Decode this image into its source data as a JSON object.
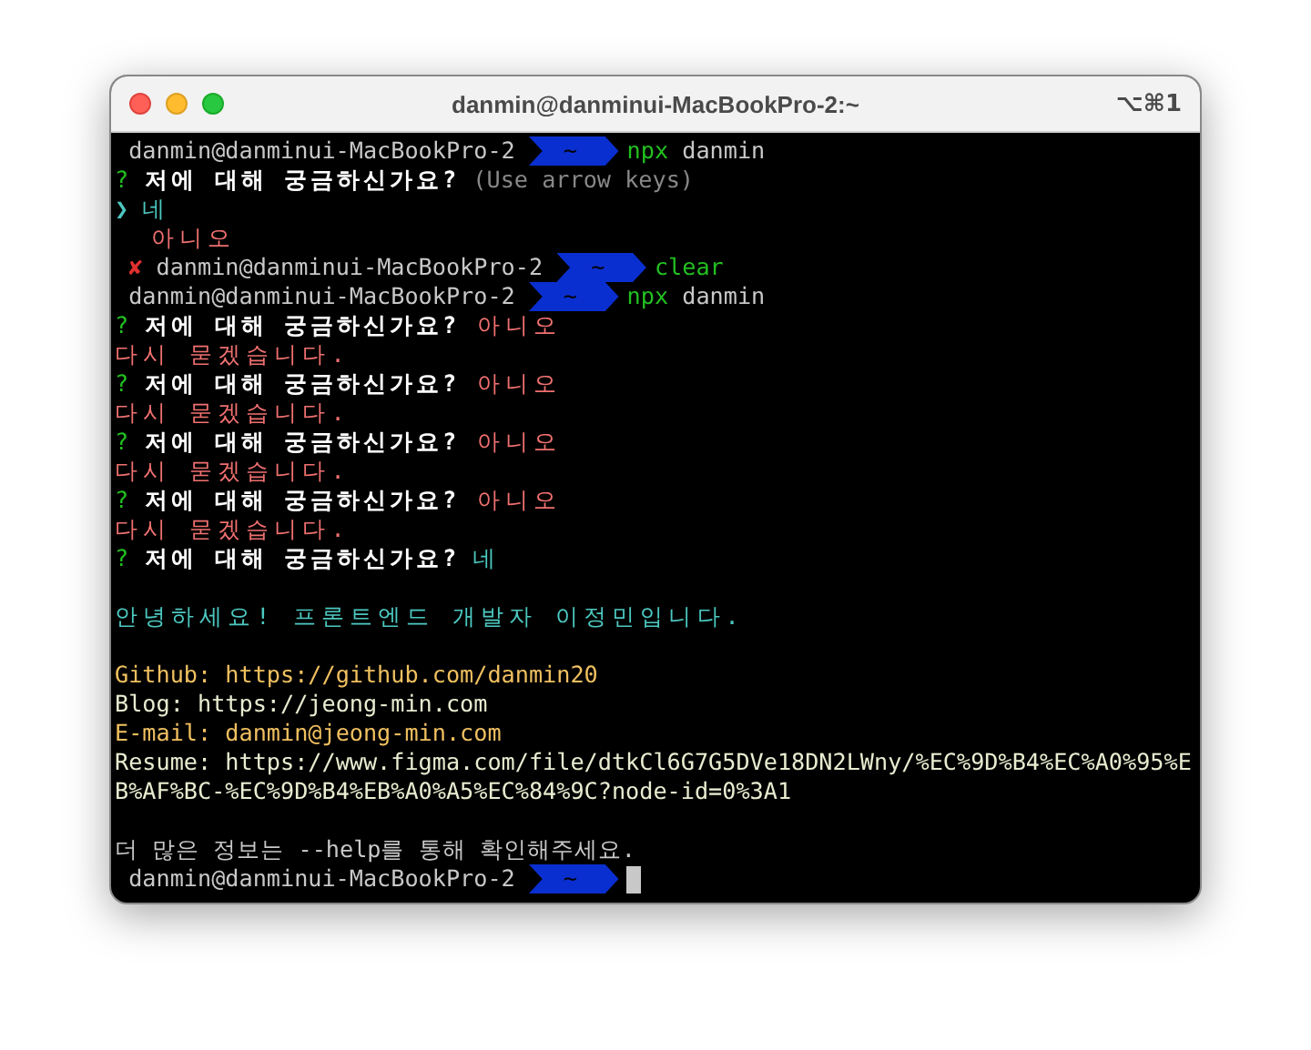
{
  "window": {
    "title": "danmin@danminui-MacBookPro-2:~",
    "shortcut": "⌥⌘1"
  },
  "lines": [
    {
      "segments": [
        {
          "kind": "host",
          "text": "danmin@danminui-MacBookPro-2"
        },
        {
          "kind": "dir",
          "text": "~"
        },
        {
          "kind": "command",
          "text": "npx"
        },
        {
          "kind": "plain",
          "text": " danmin"
        }
      ]
    },
    {
      "segments": [
        {
          "kind": "mark",
          "text": "?"
        },
        {
          "kind": "question",
          "text": " 저에 대해 궁금하신가요?"
        },
        {
          "kind": "hint",
          "text": " (Use arrow keys)"
        }
      ]
    },
    {
      "segments": [
        {
          "kind": "pointer",
          "text": "❯"
        },
        {
          "kind": "yes",
          "text": " 네"
        }
      ]
    },
    {
      "segments": [
        {
          "kind": "no",
          "text": "  아니오"
        }
      ]
    },
    {
      "segments": [
        {
          "kind": "error",
          "text": "✘"
        },
        {
          "kind": "host",
          "text": "danmin@danminui-MacBookPro-2"
        },
        {
          "kind": "dir",
          "text": "~"
        },
        {
          "kind": "command",
          "text": "clear"
        }
      ]
    },
    {
      "segments": [
        {
          "kind": "host",
          "text": "danmin@danminui-MacBookPro-2"
        },
        {
          "kind": "dir",
          "text": "~"
        },
        {
          "kind": "command",
          "text": "npx"
        },
        {
          "kind": "plain",
          "text": " danmin"
        }
      ]
    },
    {
      "segments": [
        {
          "kind": "mark",
          "text": "?"
        },
        {
          "kind": "question",
          "text": " 저에 대해 궁금하신가요?"
        },
        {
          "kind": "no",
          "text": " 아니오"
        }
      ]
    },
    {
      "segments": [
        {
          "kind": "no",
          "text": "다시 묻겠습니다."
        }
      ]
    },
    {
      "segments": [
        {
          "kind": "mark",
          "text": "?"
        },
        {
          "kind": "question",
          "text": " 저에 대해 궁금하신가요?"
        },
        {
          "kind": "no",
          "text": " 아니오"
        }
      ]
    },
    {
      "segments": [
        {
          "kind": "no",
          "text": "다시 묻겠습니다."
        }
      ]
    },
    {
      "segments": [
        {
          "kind": "mark",
          "text": "?"
        },
        {
          "kind": "question",
          "text": " 저에 대해 궁금하신가요?"
        },
        {
          "kind": "no",
          "text": " 아니오"
        }
      ]
    },
    {
      "segments": [
        {
          "kind": "no",
          "text": "다시 묻겠습니다."
        }
      ]
    },
    {
      "segments": [
        {
          "kind": "mark",
          "text": "?"
        },
        {
          "kind": "question",
          "text": " 저에 대해 궁금하신가요?"
        },
        {
          "kind": "no",
          "text": " 아니오"
        }
      ]
    },
    {
      "segments": [
        {
          "kind": "no",
          "text": "다시 묻겠습니다."
        }
      ]
    },
    {
      "segments": [
        {
          "kind": "mark",
          "text": "?"
        },
        {
          "kind": "question",
          "text": " 저에 대해 궁금하신가요?"
        },
        {
          "kind": "yes",
          "text": " 네"
        }
      ]
    },
    {
      "blank": true
    },
    {
      "segments": [
        {
          "kind": "info",
          "text": "안녕하세요! 프론트엔드 개발자 이정민입니다."
        }
      ]
    },
    {
      "blank": true
    },
    {
      "segments": [
        {
          "kind": "link",
          "text": "Github: https://github.com/danmin20"
        }
      ]
    },
    {
      "segments": [
        {
          "kind": "text",
          "text": "Blog: https://jeong-min.com"
        }
      ]
    },
    {
      "segments": [
        {
          "kind": "link",
          "text": "E-mail: danmin@jeong-min.com"
        }
      ]
    },
    {
      "segments": [
        {
          "kind": "text",
          "text": "Resume: https://www.figma.com/file/dtkCl6G7G5DVe18DN2LWny/%EC%9D%B4%EC%A0%95%E"
        }
      ]
    },
    {
      "segments": [
        {
          "kind": "text",
          "text": "B%AF%BC-%EC%9D%B4%EB%A0%A5%EC%84%9C?node-id=0%3A1"
        }
      ]
    },
    {
      "blank": true
    },
    {
      "segments": [
        {
          "kind": "plain",
          "text": "더 많은 정보는 --help를 통해 확인해주세요."
        }
      ]
    },
    {
      "segments": [
        {
          "kind": "host",
          "text": "danmin@danminui-MacBookPro-2"
        },
        {
          "kind": "dir",
          "text": "~"
        }
      ],
      "cursor": true
    }
  ]
}
